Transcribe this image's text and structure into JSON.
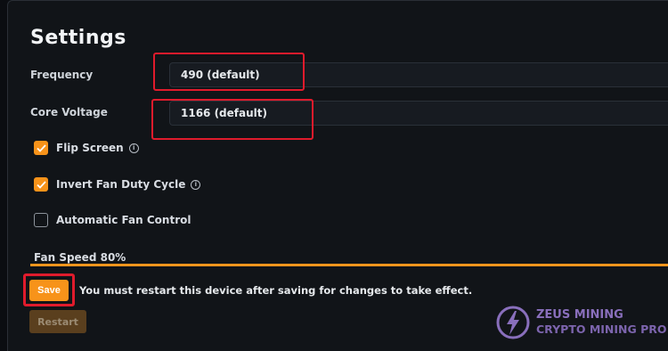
{
  "page": {
    "title": "Settings"
  },
  "frequency": {
    "label": "Frequency",
    "value": "490 (default)"
  },
  "core_voltage": {
    "label": "Core Voltage",
    "value": "1166 (default)"
  },
  "options": [
    {
      "label": "Flip Screen",
      "checked": true,
      "info": true
    },
    {
      "label": "Invert Fan Duty Cycle",
      "checked": true,
      "info": true
    },
    {
      "label": "Automatic Fan Control",
      "checked": false,
      "info": false
    }
  ],
  "fan_speed": {
    "label": "Fan Speed 80%",
    "percent": 80
  },
  "actions": {
    "save_label": "Save",
    "restart_note": "You must restart this device after saving for changes to take effect.",
    "restart_label": "Restart"
  },
  "watermark": {
    "line1": "ZEUS MINING",
    "line2": "CRYPTO MINING PRO"
  },
  "colors": {
    "accent": "#f7931a",
    "highlight_box": "#e01b2c",
    "watermark": "#9f7fd9"
  }
}
